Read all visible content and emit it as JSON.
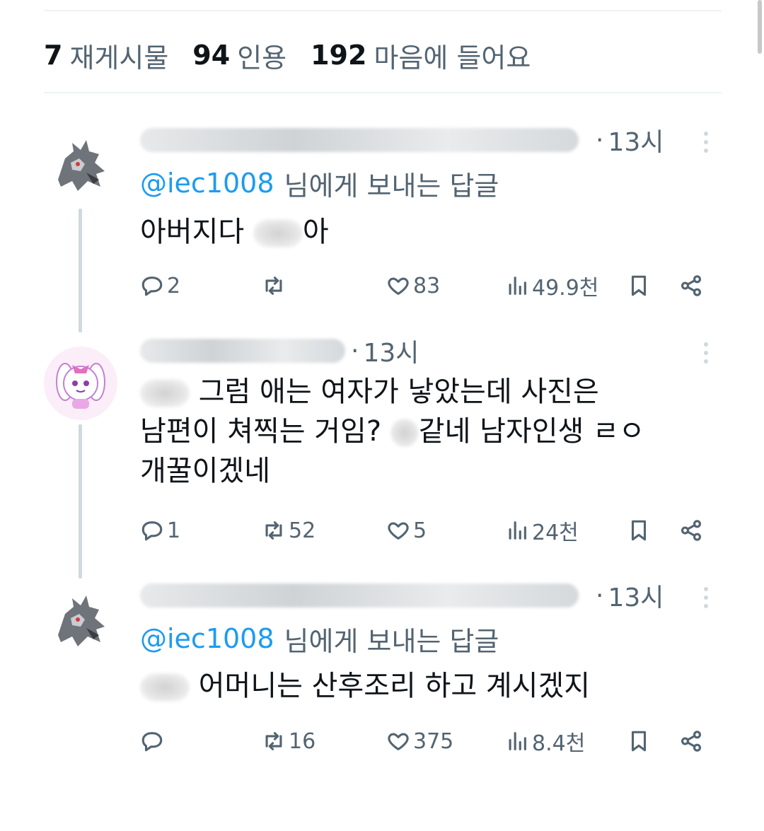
{
  "stats": {
    "reposts_count": "7",
    "reposts_label": "재게시물",
    "quotes_count": "94",
    "quotes_label": "인용",
    "likes_count": "192",
    "likes_label": "마음에 들어요"
  },
  "replies": [
    {
      "avatar_icon": "dragon-avatar-icon",
      "username": "",
      "time": "13시",
      "reply_to_handle": "@iec1008",
      "reply_to_label": "님에게 보내는 답글",
      "text_before": "아버지다 ",
      "text_after": "아",
      "actions": {
        "reply": "2",
        "repost": "",
        "like": "83",
        "views": "49.9천"
      }
    },
    {
      "avatar_icon": "pink-bunny-avatar-icon",
      "username": "",
      "time": "13시",
      "line1_after": " 그럼 애는 여자가 낳았는데 사진은",
      "line2_before": "남편이 쳐찍는 거임? ",
      "line2_after": "같네 남자인생 ㄹㅇ",
      "line3": "개꿀이겠네",
      "actions": {
        "reply": "1",
        "repost": "52",
        "like": "5",
        "views": "24천"
      }
    },
    {
      "avatar_icon": "dragon-avatar-icon",
      "username": "",
      "time": "13시",
      "reply_to_handle": "@iec1008",
      "reply_to_label": "님에게 보내는 답글",
      "text_after": " 어머니는 산후조리 하고 계시겠지",
      "actions": {
        "reply": "",
        "repost": "16",
        "like": "375",
        "views": "8.4천"
      }
    }
  ]
}
